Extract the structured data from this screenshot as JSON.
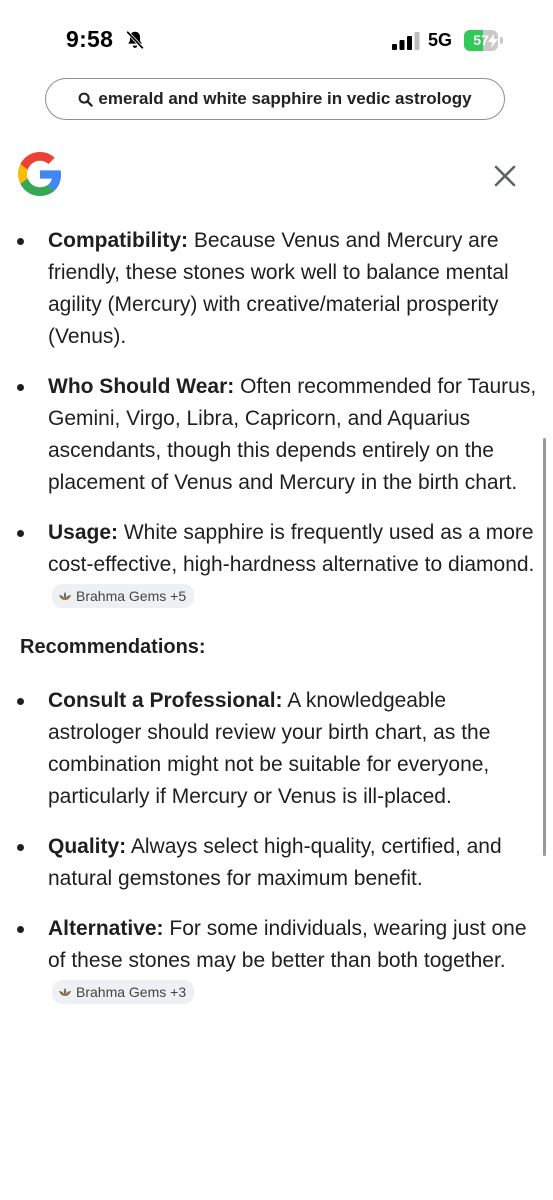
{
  "status_bar": {
    "time": "9:58",
    "network": "5G",
    "battery_level": "57",
    "battery_fraction": 0.57,
    "icons": [
      "bell-slash-icon",
      "cellular-signal-icon",
      "battery-icon"
    ]
  },
  "search": {
    "query": "emerald and white sapphire in vedic astrology"
  },
  "colors": {
    "google_blue": "#4285F4",
    "google_red": "#EA4335",
    "google_yellow": "#FBBC05",
    "google_green": "#34A853",
    "chip_bg": "#eef0f3",
    "battery_green": "#34c759"
  },
  "list1": [
    {
      "label": "Compatibility:",
      "text": " Because Venus and Mercury are friendly, these stones work well to balance mental agility (Mercury) with creative/material prosperity (Venus).",
      "source": ""
    },
    {
      "label": "Who Should Wear:",
      "text": " Often recommended for Taurus, Gemini, Virgo, Libra, Capricorn, and Aquarius ascendants, though this depends entirely on the placement of Venus and Mercury in the birth chart.",
      "source": ""
    },
    {
      "label": "Usage:",
      "text": " White sapphire is frequently used as a more cost-effective, high-hardness alternative to diamond.",
      "source": "Brahma Gems +5"
    }
  ],
  "section_heading": "Recommendations:",
  "list2": [
    {
      "label": "Consult a Professional:",
      "text": " A knowledgeable astrologer should review your birth chart, as the combination might not be suitable for everyone, particularly if Mercury or Venus is ill-placed.",
      "source": ""
    },
    {
      "label": "Quality:",
      "text": " Always select high-quality, certified, and natural gemstones for maximum benefit.",
      "source": ""
    },
    {
      "label": "Alternative:",
      "text": " For some individuals, wearing just one of these stones may be better than both together.",
      "source": "Brahma Gems +3"
    }
  ]
}
